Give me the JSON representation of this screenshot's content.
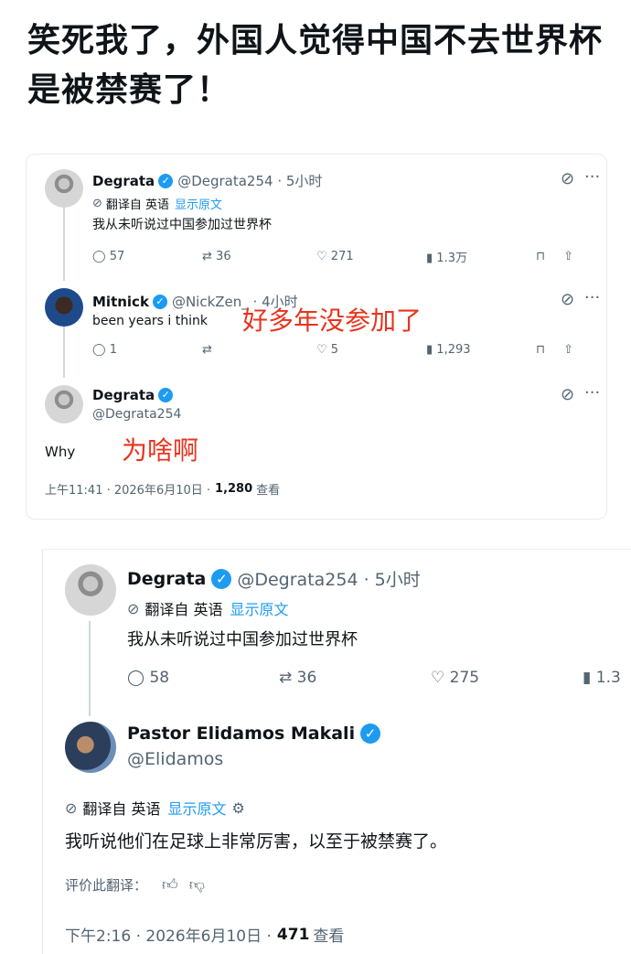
{
  "caption": "笑死我了，外国人觉得中国不去世界杯是被禁赛了！",
  "top_card": {
    "tweet1": {
      "name": "Degrata",
      "handle": "@Degrata254 · 5小时",
      "translated_from": "翻译自 英语",
      "show_original": "显示原文",
      "text": "我从未听说过中国参加过世界杯",
      "replies": "57",
      "retweets": "36",
      "likes": "271",
      "views": "1.3万"
    },
    "tweet2": {
      "name": "Mitnick",
      "handle": "@NickZen_ · 4小时",
      "text": "been years i think",
      "annotation": "好多年没参加了",
      "replies": "1",
      "retweets": "",
      "likes": "5",
      "views": "1,293"
    },
    "tweet3": {
      "name": "Degrata",
      "handle": "@Degrata254",
      "text": "Why",
      "annotation": "为啥啊",
      "timestamp": "上午11:41 · 2026年6月10日 ·",
      "views_count": "1,280",
      "views_label": "查看"
    }
  },
  "bottom_card": {
    "tweet1": {
      "name": "Degrata",
      "handle": "@Degrata254 · 5小时",
      "translated_from": "翻译自 英语",
      "show_original": "显示原文",
      "text": "我从未听说过中国参加过世界杯",
      "replies": "58",
      "retweets": "36",
      "likes": "275",
      "views": "1.3"
    },
    "tweet2": {
      "name": "Pastor Elidamos Makali",
      "handle": "@Elidamos",
      "translated_from": "翻译自 英语",
      "show_original": "显示原文",
      "text": "我听说他们在足球上非常厉害，以至于被禁赛了。",
      "rate_translation": "评价此翻译：",
      "timestamp": "下午2:16 · 2026年6月10日 ·",
      "views_count": "471",
      "views_label": "查看"
    }
  },
  "icons": [
    "reply-icon",
    "retweet-icon",
    "like-icon",
    "views-icon",
    "bookmark-icon",
    "share-icon",
    "grok-icon",
    "more-icon",
    "verified-icon",
    "translate-icon",
    "thumb-up-icon",
    "thumb-down-icon",
    "gear-icon"
  ],
  "colors": {
    "accent": "#1d9bf0",
    "muted": "#536471",
    "annotation": "#e8331c"
  }
}
